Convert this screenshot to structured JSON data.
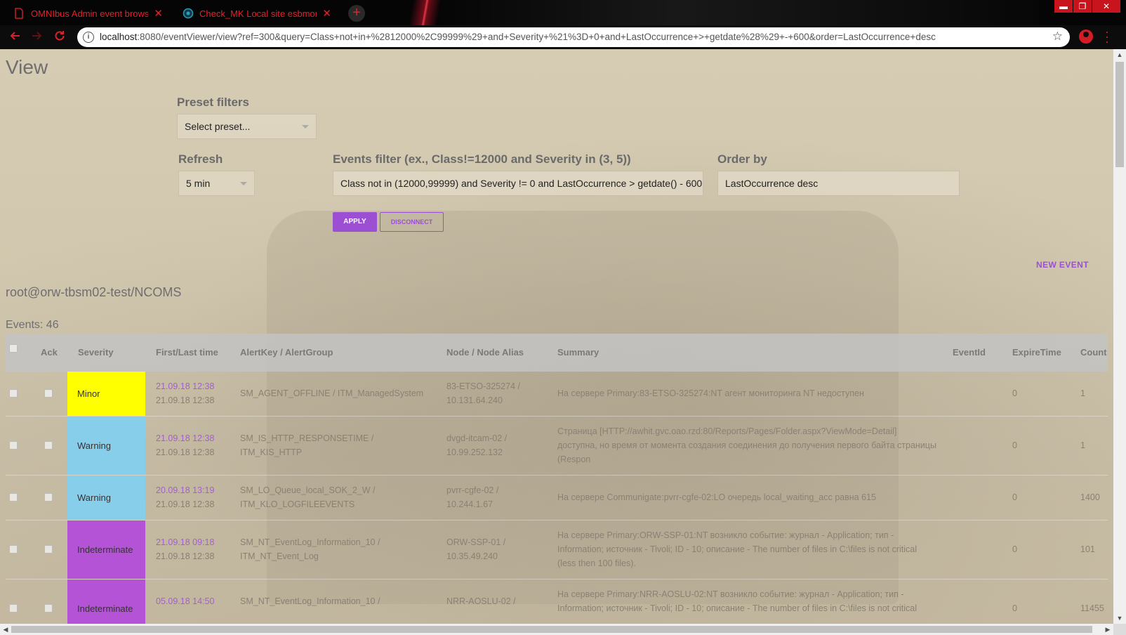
{
  "browser": {
    "tabs": [
      {
        "title": "OMNIbus Admin event browse",
        "close": "✕"
      },
      {
        "title": "Check_MK Local site esbmon",
        "close": "✕"
      }
    ],
    "new_tab": "+",
    "url_host": "localhost",
    "url_rest": ":8080/eventViewer/view?ref=300&query=Class+not+in+%2812000%2C99999%29+and+Severity+%21%3D+0+and+LastOccurrence+>+getdate%28%29+-+600&order=LastOccurrence+desc",
    "window_buttons": {
      "minimize": "▬",
      "restore": "❐",
      "close": "✕"
    }
  },
  "page": {
    "title": "View",
    "preset": {
      "label": "Preset filters",
      "value": "Select preset..."
    },
    "refresh": {
      "label": "Refresh",
      "value": "5 min"
    },
    "filter": {
      "label": "Events filter (ex., Class!=12000 and Severity in (3, 5))",
      "value": "Class not in (12000,99999) and Severity != 0 and LastOccurrence > getdate() - 600"
    },
    "order": {
      "label": "Order by",
      "value": "LastOccurrence desc"
    },
    "apply_label": "APPLY",
    "disconnect_label": "DISCONNECT",
    "new_event_label": "NEW EVENT",
    "connection": "root@orw-tbsm02-test/NCOMS",
    "events_count": "Events: 46"
  },
  "table": {
    "headers": {
      "ack": "Ack",
      "severity": "Severity",
      "time": "First/Last time",
      "alert": "AlertKey / AlertGroup",
      "node": "Node / Node Alias",
      "summary": "Summary",
      "eventid": "EventId",
      "expire": "ExpireTime",
      "count": "Count"
    },
    "rows": [
      {
        "severity": "Minor",
        "color": "#ffff00",
        "first": "21.09.18 12:38",
        "last": "21.09.18 12:38",
        "alert1": "SM_AGENT_OFFLINE / ITM_ManagedSystem",
        "alert2": "",
        "node1": "83-ETSO-325274 /",
        "node2": "10.131.64.240",
        "summary": "На сервере Primary:83-ETSO-325274:NT агент мониторинга NT недоступен",
        "eventid": "",
        "expire": "0",
        "count": "1"
      },
      {
        "severity": "Warning",
        "color": "#87ceeb",
        "first": "21.09.18 12:38",
        "last": "21.09.18 12:38",
        "alert1": "SM_IS_HTTP_RESPONSETIME /",
        "alert2": "ITM_KIS_HTTP",
        "node1": "dvgd-itcam-02 /",
        "node2": "10.99.252.132",
        "summary": "Страница [HTTP://awhit.gvc.oao.rzd:80/Reports/Pages/Folder.aspx?ViewMode=Detail] доступна, но время от момента создания соединения до получения первого байта страницы (Respon",
        "eventid": "",
        "expire": "0",
        "count": "1"
      },
      {
        "severity": "Warning",
        "color": "#87ceeb",
        "first": "20.09.18 13:19",
        "last": "21.09.18 12:38",
        "alert1": "SM_LO_Queue_local_SOK_2_W /",
        "alert2": "ITM_KLO_LOGFILEEVENTS",
        "node1": "pvrr-cgfe-02 /",
        "node2": "10.244.1.67",
        "summary": "На сервере Communigate:pvrr-cgfe-02:LO очередь local_waiting_acc равна 615",
        "eventid": "",
        "expire": "0",
        "count": "1400"
      },
      {
        "severity": "Indeterminate",
        "color": "#b553d6",
        "first": "21.09.18 09:18",
        "last": "21.09.18 12:38",
        "alert1": "SM_NT_EventLog_Information_10 /",
        "alert2": "ITM_NT_Event_Log",
        "node1": "ORW-SSP-01 /",
        "node2": "10.35.49.240",
        "summary": "На сервере Primary:ORW-SSP-01:NT возникло событие: журнал - Application; тип - Information; источник - Tivoli; ID - 10; описание - The number of files in C:\\files is not critical (less then 100 files).",
        "eventid": "",
        "expire": "0",
        "count": "101"
      },
      {
        "severity": "Indeterminate",
        "color": "#b553d6",
        "first": "05.09.18 14:50",
        "last": "",
        "alert1": "SM_NT_EventLog_Information_10 /",
        "alert2": "",
        "node1": "NRR-AOSLU-02 /",
        "node2": "",
        "summary": "На сервере Primary:NRR-AOSLU-02:NT возникло событие: журнал - Application; тип - Information; источник - Tivoli; ID - 10; описание - The number of files in C:\\files is not critical",
        "eventid": "",
        "expire": "0",
        "count": "11455"
      }
    ]
  },
  "colors": {
    "accent": "#9c4fd3",
    "tab_text": "#e8202a",
    "window_close": "#c8141c"
  },
  "icons": [
    "file-icon",
    "checkmk-icon",
    "back-arrow-icon",
    "forward-arrow-icon",
    "reload-icon",
    "info-icon",
    "star-icon",
    "profile-icon",
    "kebab-menu-icon"
  ]
}
